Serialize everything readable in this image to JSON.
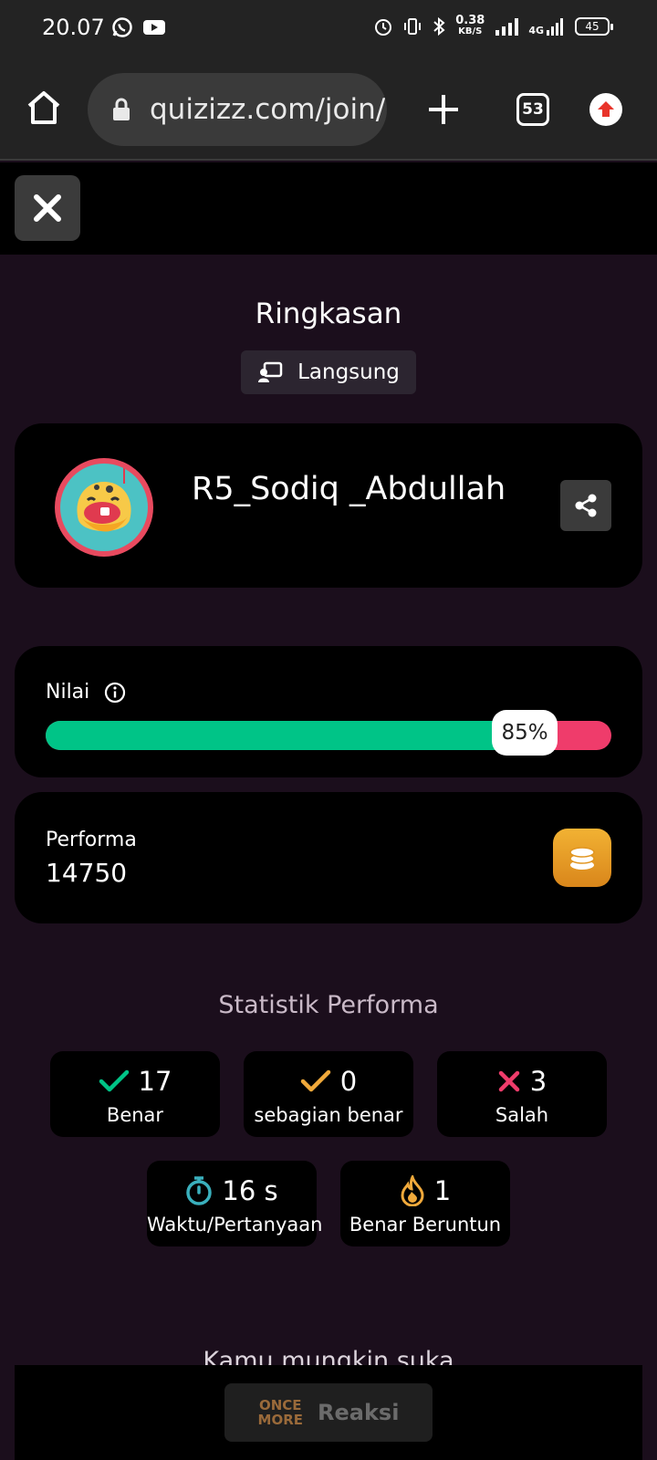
{
  "status_bar": {
    "time": "20.07",
    "net_speed_value": "0.38",
    "net_speed_unit": "KB/S",
    "network_type": "4G",
    "battery": "45"
  },
  "browser": {
    "url": "quizizz.com/join/",
    "tab_count": "53"
  },
  "summary": {
    "title": "Ringkasan",
    "mode": "Langsung"
  },
  "player": {
    "name": "R5_Sodiq _Abdullah"
  },
  "score": {
    "label": "Nilai",
    "percent_text": "85%",
    "percent": 85
  },
  "performance": {
    "label": "Performa",
    "value": "14750"
  },
  "stats": {
    "title": "Statistik Performa",
    "correct_value": "17",
    "correct_label": "Benar",
    "partial_value": "0",
    "partial_label": "sebagian benar",
    "wrong_value": "3",
    "wrong_label": "Salah",
    "time_value": "16 s",
    "time_label": "Waktu/Pertanyaan",
    "streak_value": "1",
    "streak_label": "Benar Beruntun"
  },
  "recommend": {
    "title": "Kamu mungkin suka"
  },
  "reaction": {
    "logo_line1": "ONCE",
    "logo_line2": "MORE",
    "label": "Reaksi"
  },
  "colors": {
    "correct": "#00c487",
    "wrong": "#ef3c6b",
    "partial": "#f0a93b",
    "timer": "#3ab0bd",
    "streak": "#f0a93b"
  }
}
